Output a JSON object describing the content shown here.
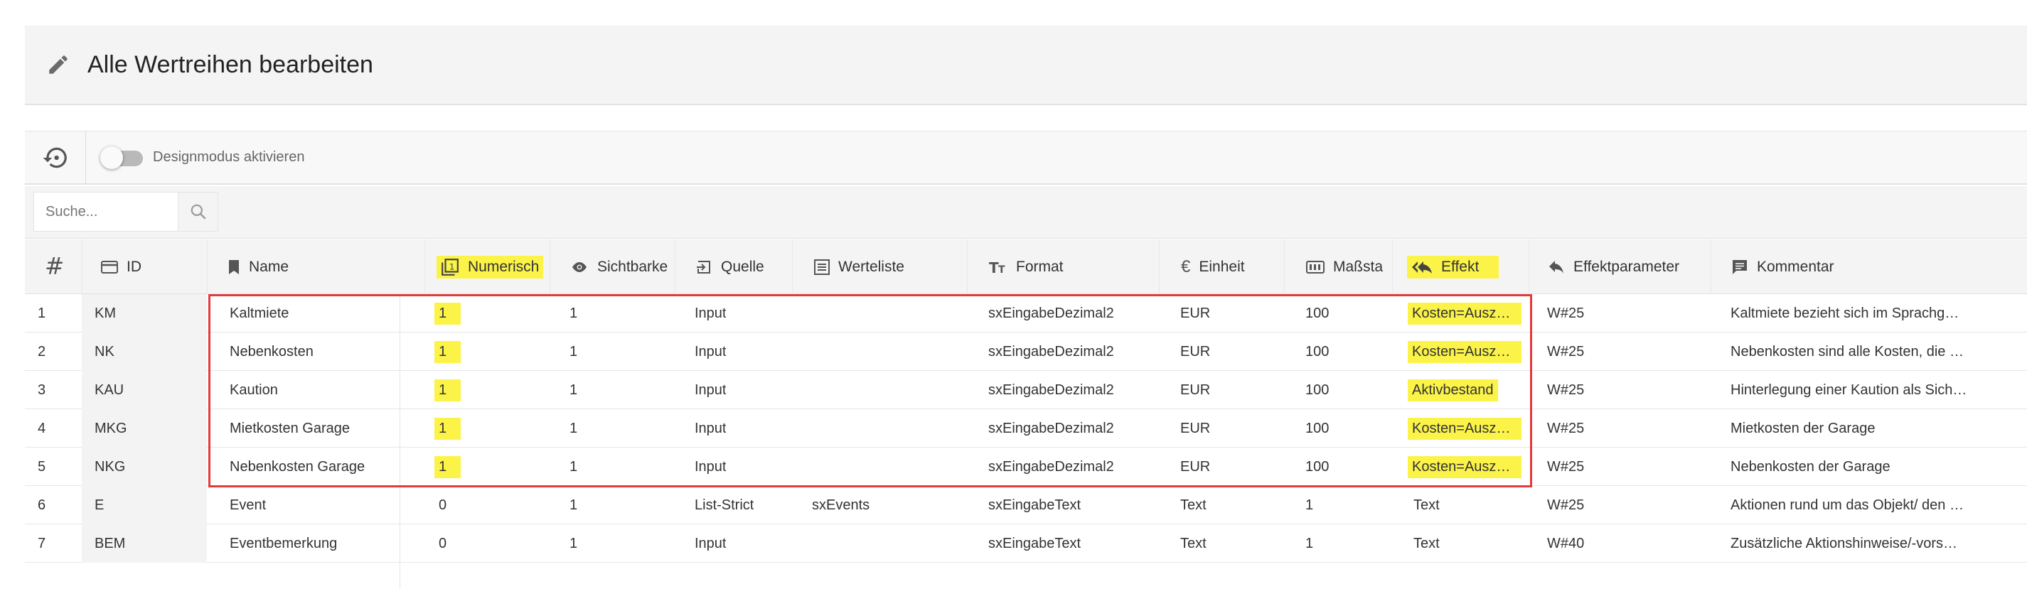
{
  "header": {
    "title": "Alle Wertreihen bearbeiten",
    "icon": "pencil-icon"
  },
  "toolbar": {
    "reset_icon": "history-reset-icon",
    "designmode_label": "Designmodus aktivieren"
  },
  "search": {
    "placeholder": "Suche...",
    "value": ""
  },
  "columns": [
    {
      "key": "idx",
      "label": "#",
      "icon": "hash-icon"
    },
    {
      "key": "id",
      "label": "ID",
      "icon": "card-icon"
    },
    {
      "key": "name",
      "label": "Name",
      "icon": "bookmark-icon"
    },
    {
      "key": "numerisch",
      "label": "Numerisch",
      "icon": "numbered-box-icon",
      "highlighted": true
    },
    {
      "key": "sichtbarkeit",
      "label": "Sichtbarke",
      "icon": "eye-icon"
    },
    {
      "key": "quelle",
      "label": "Quelle",
      "icon": "input-icon"
    },
    {
      "key": "werteliste",
      "label": "Werteliste",
      "icon": "list-icon"
    },
    {
      "key": "format",
      "label": "Format",
      "icon": "text-format-icon"
    },
    {
      "key": "einheit",
      "label": "Einheit",
      "icon": "euro-icon"
    },
    {
      "key": "massstab",
      "label": "Maßsta",
      "icon": "counter-icon"
    },
    {
      "key": "effekt",
      "label": "Effekt",
      "icon": "reply-all-icon",
      "highlighted": true
    },
    {
      "key": "effektparameter",
      "label": "Effektparameter",
      "icon": "reply-icon"
    },
    {
      "key": "kommentar",
      "label": "Kommentar",
      "icon": "comment-icon"
    }
  ],
  "rows": [
    {
      "idx": "1",
      "id": "KM",
      "name": "Kaltmiete",
      "numerisch": "1",
      "sichtbarkeit": "1",
      "quelle": "Input",
      "werteliste": "",
      "format": "sxEingabeDezimal2",
      "einheit": "EUR",
      "massstab": "100",
      "effekt": "Kosten=Ausza…",
      "effektparameter": "W#25",
      "kommentar": "Kaltmiete bezieht sich im Sprachg…",
      "highlighted": true
    },
    {
      "idx": "2",
      "id": "NK",
      "name": "Nebenkosten",
      "numerisch": "1",
      "sichtbarkeit": "1",
      "quelle": "Input",
      "werteliste": "",
      "format": "sxEingabeDezimal2",
      "einheit": "EUR",
      "massstab": "100",
      "effekt": "Kosten=Ausza…",
      "effektparameter": "W#25",
      "kommentar": "Nebenkosten sind alle Kosten, die …",
      "highlighted": true
    },
    {
      "idx": "3",
      "id": "KAU",
      "name": "Kaution",
      "numerisch": "1",
      "sichtbarkeit": "1",
      "quelle": "Input",
      "werteliste": "",
      "format": "sxEingabeDezimal2",
      "einheit": "EUR",
      "massstab": "100",
      "effekt": "Aktivbestand",
      "effektparameter": "W#25",
      "kommentar": "Hinterlegung einer Kaution als Sich…",
      "highlighted": true
    },
    {
      "idx": "4",
      "id": "MKG",
      "name": "Mietkosten Garage",
      "numerisch": "1",
      "sichtbarkeit": "1",
      "quelle": "Input",
      "werteliste": "",
      "format": "sxEingabeDezimal2",
      "einheit": "EUR",
      "massstab": "100",
      "effekt": "Kosten=Ausza…",
      "effektparameter": "W#25",
      "kommentar": "Mietkosten der Garage",
      "highlighted": true
    },
    {
      "idx": "5",
      "id": "NKG",
      "name": "Nebenkosten Garage",
      "numerisch": "1",
      "sichtbarkeit": "1",
      "quelle": "Input",
      "werteliste": "",
      "format": "sxEingabeDezimal2",
      "einheit": "EUR",
      "massstab": "100",
      "effekt": "Kosten=Ausza…",
      "effektparameter": "W#25",
      "kommentar": "Nebenkosten der Garage",
      "highlighted": true
    },
    {
      "idx": "6",
      "id": "E",
      "name": "Event",
      "numerisch": "0",
      "sichtbarkeit": "1",
      "quelle": "List-Strict",
      "werteliste": "sxEvents",
      "format": "sxEingabeText",
      "einheit": "Text",
      "massstab": "1",
      "effekt": "Text",
      "effektparameter": "W#25",
      "kommentar": "Aktionen rund um das Objekt/ den …",
      "highlighted": false
    },
    {
      "idx": "7",
      "id": "BEM",
      "name": "Eventbemerkung",
      "numerisch": "0",
      "sichtbarkeit": "1",
      "quelle": "Input",
      "werteliste": "",
      "format": "sxEingabeText",
      "einheit": "Text",
      "massstab": "1",
      "effekt": "Text",
      "effektparameter": "W#40",
      "kommentar": "Zusätzliche Aktionshinweise/-vors…",
      "highlighted": false
    }
  ],
  "colors": {
    "highlight": "#fbf348",
    "selection_border": "#e53a3a",
    "header_bg": "#f4f4f4"
  }
}
